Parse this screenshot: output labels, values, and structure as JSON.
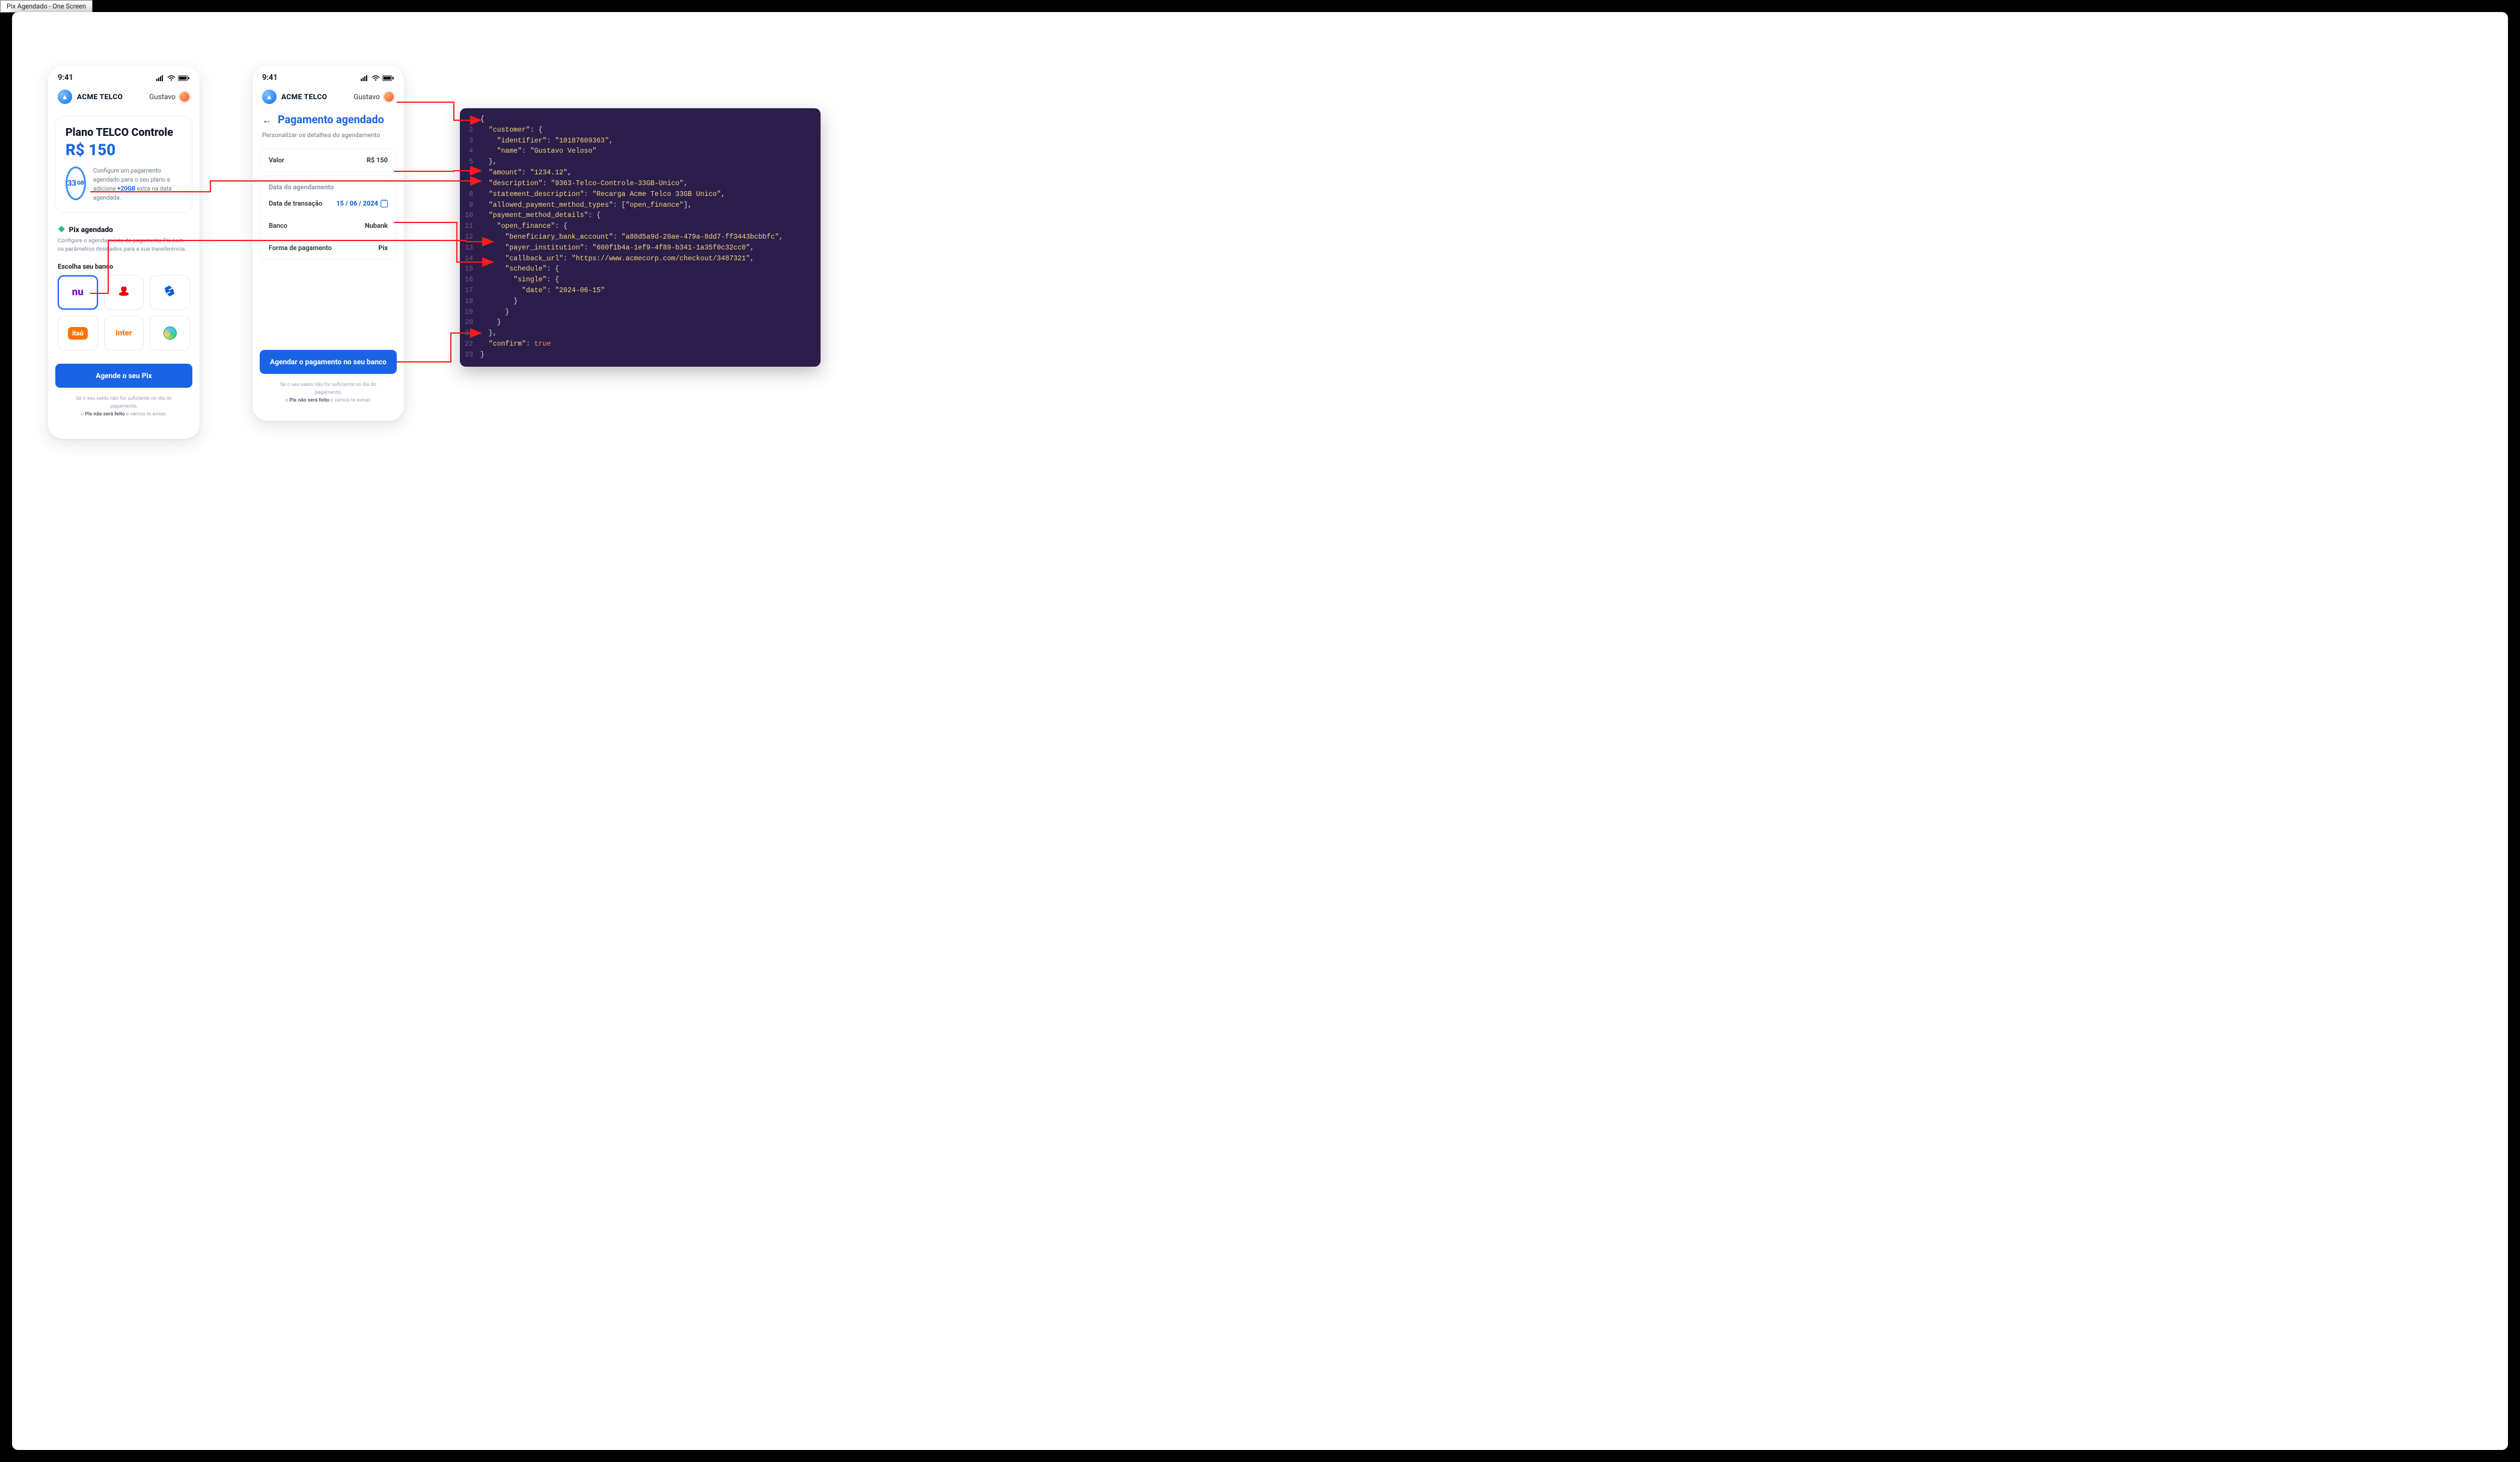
{
  "browser": {
    "tab_title": "Pix Agendado - One Screen"
  },
  "statusbar": {
    "time": "9:41"
  },
  "brand": {
    "name": "ACME TELCO",
    "logo_glyph": "▲"
  },
  "user": {
    "name": "Gustavo"
  },
  "phone1": {
    "plan_title": "Plano TELCO Controle",
    "plan_price": "R$ 150",
    "gb_amount": "33",
    "gb_unit": "GB",
    "plan_desc_1": "Configure um pagamento agendado para o seu plano e adicione ",
    "plan_desc_hl": "+20GB",
    "plan_desc_2": " extra na data agendada.",
    "pix_heading": "Pix agendado",
    "pix_sub": "Configure o agendamento do pagamento Pix com os parâmetros desejados para a sua transferência.",
    "bank_label": "Escolha seu banco",
    "banks": [
      {
        "id": "nubank",
        "label": "nu",
        "selected": true
      },
      {
        "id": "santander",
        "label": "🔥",
        "selected": false
      },
      {
        "id": "bb",
        "label": "⦿",
        "selected": false
      },
      {
        "id": "itau",
        "label": "itaú",
        "selected": false
      },
      {
        "id": "inter",
        "label": "inter",
        "selected": false
      },
      {
        "id": "wise",
        "label": "",
        "selected": false
      }
    ],
    "cta": "Agende o seu Pix",
    "fine_1": "Se o seu saldo não for suficiente no dia do pagamento,",
    "fine_2a": "o ",
    "fine_2b": "Pix não será feito",
    "fine_2c": " e vamos te avisar."
  },
  "phone2": {
    "title": "Pagamento agendado",
    "subtitle": "Personalizar os detalhes do agendamento",
    "valor_k": "Valor",
    "valor_v": "R$ 150",
    "section": "Data do agendamento",
    "data_k": "Data de transação",
    "data_v": "15 / 06 / 2024",
    "banco_k": "Banco",
    "banco_v": "Nubank",
    "forma_k": "Forma de pagamento",
    "forma_v": "Pix",
    "cta": "Agendar o pagamento no seu banco",
    "fine_1": "Se o seu saldo não for suficiente no dia do pagamento,",
    "fine_2a": "o ",
    "fine_2b": "Pix não será feito",
    "fine_2c": " e vamos te avisar."
  },
  "code": {
    "lines": [
      "{",
      "  \"customer\": {",
      "    \"identifier\": \"10187609363\",",
      "    \"name\": \"Gustavo Veloso\"",
      "  },",
      "  \"amount\": \"1234.12\",",
      "  \"description\": \"9363-Telco-Controle-33GB-Unico\",",
      "  \"statement_description\": \"Recarga Acme Telco 33GB Unico\",",
      "  \"allowed_payment_method_types\": [\"open_finance\"],",
      "  \"payment_method_details\": {",
      "    \"open_finance\": {",
      "      \"beneficiary_bank_account\": \"a80d5a9d-20ae-479a-8dd7-ff3443bcbbfc\",",
      "      \"payer_institution\": \"600f1b4a-1ef9-4f89-b341-1a35f0c32cc0\",",
      "      \"callback_url\": \"https://www.acmecorp.com/checkout/3487321\",",
      "      \"schedule\": {",
      "        \"single\": {",
      "          \"date\": \"2024-06-15\"",
      "        }",
      "      }",
      "    }",
      "  },",
      "  \"confirm\": true",
      "}"
    ]
  }
}
